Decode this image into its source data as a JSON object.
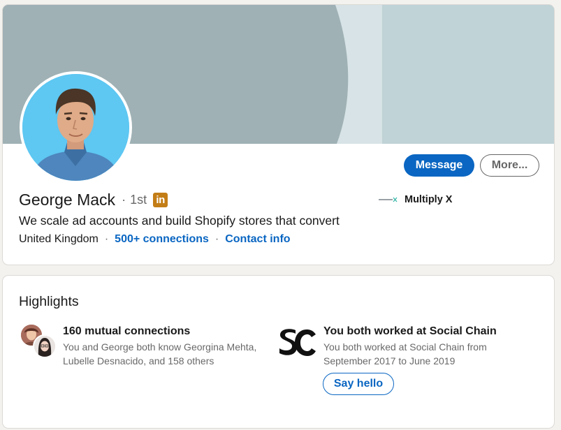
{
  "profile": {
    "name": "George Mack",
    "degree": "1st",
    "badge_text": "in",
    "headline": "We scale ad accounts and build Shopify stores that convert",
    "location": "United Kingdom",
    "connections": "500+ connections",
    "contact_info": "Contact info",
    "separator": "·"
  },
  "actions": {
    "message_label": "Message",
    "more_label": "More..."
  },
  "company": {
    "logo_text": "MULTIPLY X",
    "name": "Multiply X"
  },
  "highlights": {
    "title": "Highlights",
    "mutual": {
      "title": "160 mutual connections",
      "text": "You and George both know Georgina Mehta, Lubelle Desnacido, and 158 others"
    },
    "work": {
      "title": "You both worked at Social Chain",
      "text": "You both worked at Social Chain from September 2017 to June 2019",
      "button_label": "Say hello"
    }
  },
  "colors": {
    "accent": "#0a66c2",
    "linkedin_badge": "#c37d16",
    "banner_dark": "#9fb1b4",
    "banner_light": "#c0d3d6"
  }
}
